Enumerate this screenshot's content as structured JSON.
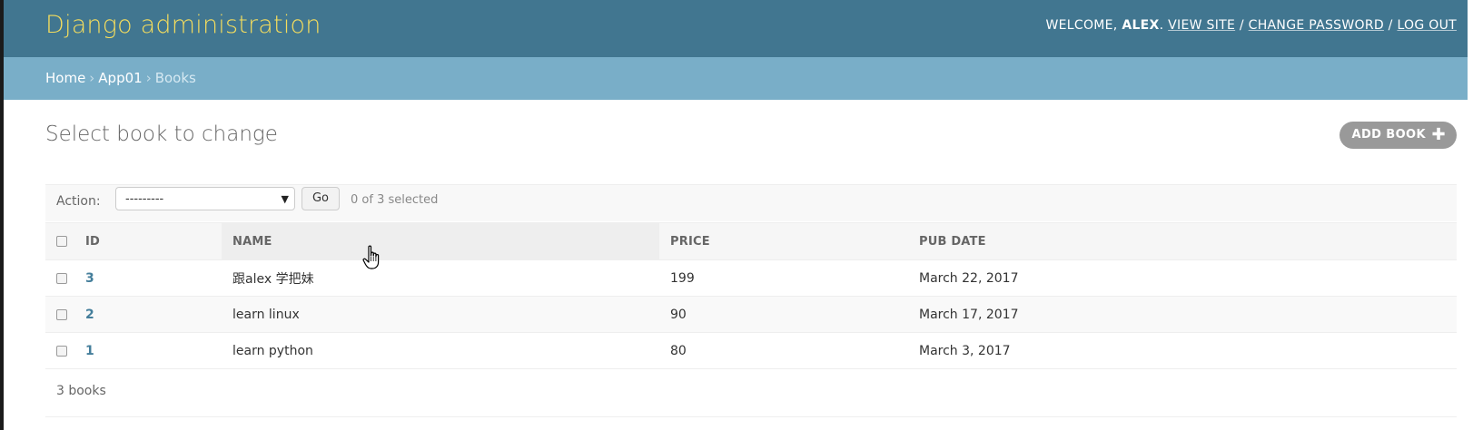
{
  "header": {
    "branding": "Django administration",
    "welcome": "Welcome,",
    "user": "alex",
    "view_site": "View site",
    "change_password": "Change password",
    "log_out": "Log out",
    "bg_color": "#417690",
    "brand_color": "#f5dd5d"
  },
  "breadcrumbs": {
    "home": "Home",
    "app": "App01",
    "current": "Books",
    "separator": "›",
    "bg_color": "#79aec8"
  },
  "main": {
    "title": "Select book to change",
    "add_button": "Add book",
    "add_icon": "plus-icon"
  },
  "actions": {
    "label": "Action:",
    "selected_option": "---------",
    "go_label": "Go",
    "counter": "0 of 3 selected"
  },
  "table": {
    "columns": [
      "ID",
      "Name",
      "Price",
      "Pub date"
    ],
    "rows": [
      {
        "id": "3",
        "name": "跟alex 学把妹",
        "price": "199",
        "pub_date": "March 22, 2017"
      },
      {
        "id": "2",
        "name": "learn linux",
        "price": "90",
        "pub_date": "March 17, 2017"
      },
      {
        "id": "1",
        "name": "learn python",
        "price": "80",
        "pub_date": "March 3, 2017"
      }
    ]
  },
  "paginator": {
    "count_text": "3 books"
  },
  "cursor": {
    "icon": "hand-pointer-icon"
  }
}
